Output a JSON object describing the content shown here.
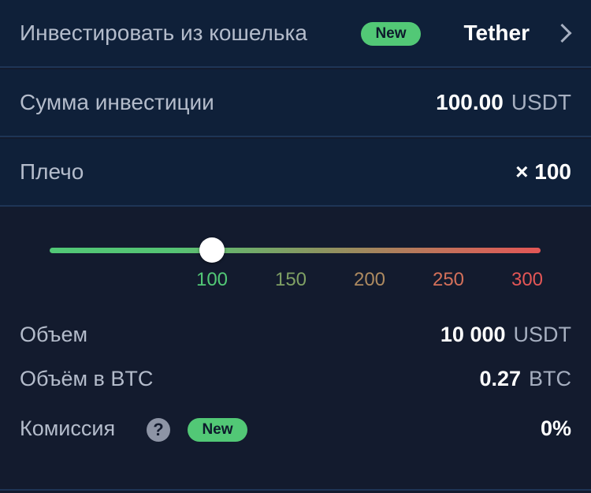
{
  "wallet_row": {
    "label": "Инвестировать из кошелька",
    "badge": "New",
    "currency": "Tether"
  },
  "amount_row": {
    "label": "Сумма инвестиции",
    "value": "100.00",
    "unit": "USDT"
  },
  "leverage_row": {
    "label": "Плечо",
    "value": "× 100"
  },
  "slider": {
    "min": 100,
    "max": 300,
    "current": 100,
    "ticks": [
      {
        "label": "100",
        "color": "#52c876"
      },
      {
        "label": "150",
        "color": "#7fa064"
      },
      {
        "label": "200",
        "color": "#ad8a60"
      },
      {
        "label": "250",
        "color": "#d3705a"
      },
      {
        "label": "300",
        "color": "#e35656"
      }
    ]
  },
  "volume": {
    "label": "Объем",
    "value": "10 000",
    "unit": "USDT"
  },
  "volume_btc": {
    "label": "Объём в BTC",
    "value": "0.27",
    "unit": "BTC"
  },
  "commission": {
    "label": "Комиссия",
    "help": "?",
    "badge": "New",
    "value": "0%"
  },
  "colors": {
    "badge_green": "#52c876",
    "row_bg": "#0f2039",
    "page_bg": "#131b2e"
  },
  "icons": {
    "chevron": "chevron-right-icon",
    "help": "question-circle-icon"
  }
}
